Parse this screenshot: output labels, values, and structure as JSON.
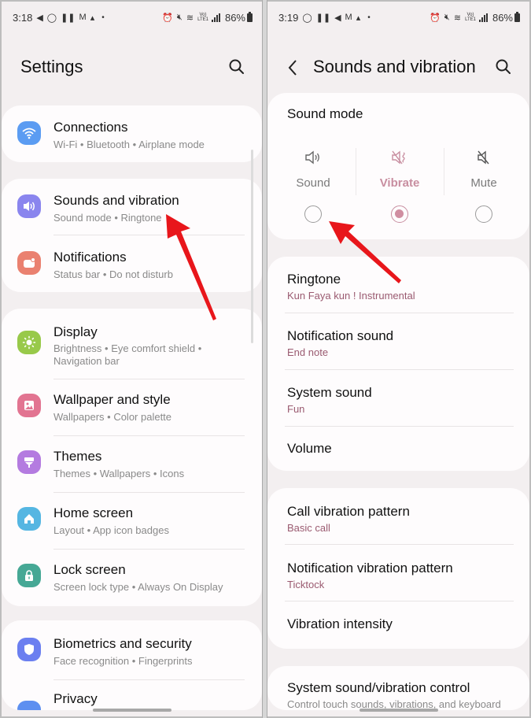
{
  "left_screen": {
    "status": {
      "time": "3:18",
      "battery": "86%",
      "icons": [
        "telegram-icon",
        "whatsapp-icon",
        "pause-icon",
        "gmail-icon",
        "cloud-icon",
        "dot"
      ],
      "right_icons": [
        "alarm-icon",
        "mute-icon",
        "wifi-icon",
        "volte-icon",
        "signal-icon"
      ]
    },
    "header": {
      "title": "Settings",
      "search_icon": "search-icon"
    },
    "groups": [
      {
        "items": [
          {
            "title": "Connections",
            "subtitle": "Wi-Fi  •  Bluetooth  •  Airplane mode",
            "icon": "wifi-icon",
            "color": "#5b9cf2"
          }
        ]
      },
      {
        "items": [
          {
            "title": "Sounds and vibration",
            "subtitle": "Sound mode  •  Ringtone",
            "icon": "speaker-icon",
            "color": "#8a85ee"
          },
          {
            "title": "Notifications",
            "subtitle": "Status bar  •  Do not disturb",
            "icon": "notification-icon",
            "color": "#ea8170"
          }
        ]
      },
      {
        "items": [
          {
            "title": "Display",
            "subtitle": "Brightness  •  Eye comfort shield  •",
            "subtitle2": "Navigation bar",
            "icon": "sun-icon",
            "color": "#98c94a"
          },
          {
            "title": "Wallpaper and style",
            "subtitle": "Wallpapers  •  Color palette",
            "icon": "image-icon",
            "color": "#e27491"
          },
          {
            "title": "Themes",
            "subtitle": "Themes  •  Wallpapers  •  Icons",
            "icon": "brush-icon",
            "color": "#b47be0"
          },
          {
            "title": "Home screen",
            "subtitle": "Layout  •  App icon badges",
            "icon": "home-icon",
            "color": "#55b6e2"
          },
          {
            "title": "Lock screen",
            "subtitle": "Screen lock type  •  Always On Display",
            "icon": "lock-icon",
            "color": "#46a895"
          }
        ]
      },
      {
        "items": [
          {
            "title": "Biometrics and security",
            "subtitle": "Face recognition  •  Fingerprints",
            "icon": "shield-icon",
            "color": "#6b7ff0"
          },
          {
            "title": "Privacy",
            "icon": "privacy-icon",
            "color": "#5d8ff0"
          }
        ]
      }
    ]
  },
  "right_screen": {
    "status": {
      "time": "3:19",
      "battery": "86%"
    },
    "header": {
      "title": "Sounds and vibration",
      "back_icon": "back-icon",
      "search_icon": "search-icon"
    },
    "sound_mode": {
      "title": "Sound mode",
      "options": [
        {
          "label": "Sound",
          "icon": "speaker-icon",
          "selected": false
        },
        {
          "label": "Vibrate",
          "icon": "vibrate-icon",
          "selected": true
        },
        {
          "label": "Mute",
          "icon": "mute-icon",
          "selected": false
        }
      ]
    },
    "sound_group": [
      {
        "title": "Ringtone",
        "subtitle": "Kun Faya kun ! Instrumental"
      },
      {
        "title": "Notification sound",
        "subtitle": "End note"
      },
      {
        "title": "System sound",
        "subtitle": "Fun"
      },
      {
        "title": "Volume"
      }
    ],
    "vibration_group": [
      {
        "title": "Call vibration pattern",
        "subtitle": "Basic call"
      },
      {
        "title": "Notification vibration pattern",
        "subtitle": "Ticktock"
      },
      {
        "title": "Vibration intensity"
      }
    ],
    "control_group": [
      {
        "title": "System sound/vibration control",
        "subtitle": "Control touch sounds, vibrations, and keyboard"
      }
    ]
  },
  "colors": {
    "accent": "#c88ea0",
    "annotation_arrow": "#e8161b",
    "background": "#f3eff0",
    "card": "#fefcfd"
  }
}
